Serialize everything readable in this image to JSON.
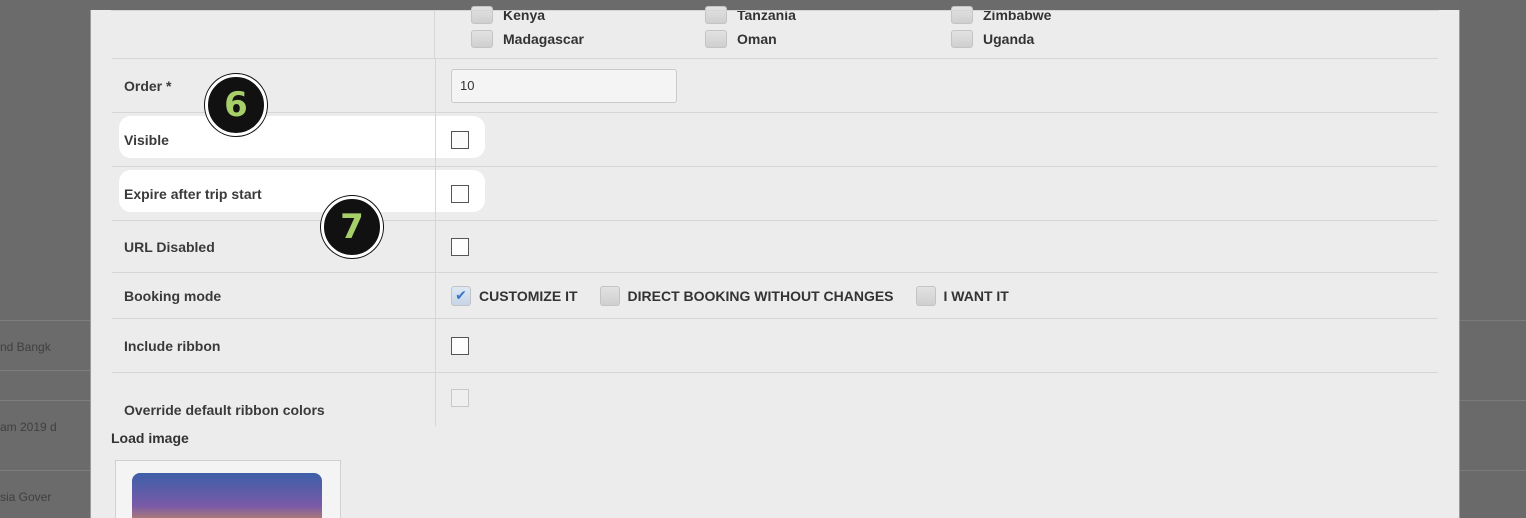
{
  "background": {
    "snippets": [
      "nd Bangk",
      "am 2019 d",
      "sia Gover"
    ]
  },
  "countries": [
    {
      "name": "Kenya"
    },
    {
      "name": "Tanzania"
    },
    {
      "name": "Zimbabwe"
    },
    {
      "name": "Madagascar"
    },
    {
      "name": "Oman"
    },
    {
      "name": "Uganda"
    }
  ],
  "form": {
    "order_label": "Order *",
    "order_value": "10",
    "visible_label": "Visible",
    "expire_label": "Expire after trip start",
    "url_disabled_label": "URL Disabled",
    "booking_mode_label": "Booking mode",
    "booking_options": [
      {
        "label": "CUSTOMIZE IT",
        "checked": true
      },
      {
        "label": "DIRECT BOOKING WITHOUT CHANGES",
        "checked": false
      },
      {
        "label": "I WANT IT",
        "checked": false
      }
    ],
    "include_ribbon_label": "Include ribbon",
    "override_ribbon_label": "Override default ribbon colors",
    "load_image_label": "Load image"
  },
  "annotations": {
    "badge_6": "6",
    "badge_7": "7",
    "badge_color": "#a6cf6a"
  },
  "icons": {
    "check": "check-icon"
  }
}
